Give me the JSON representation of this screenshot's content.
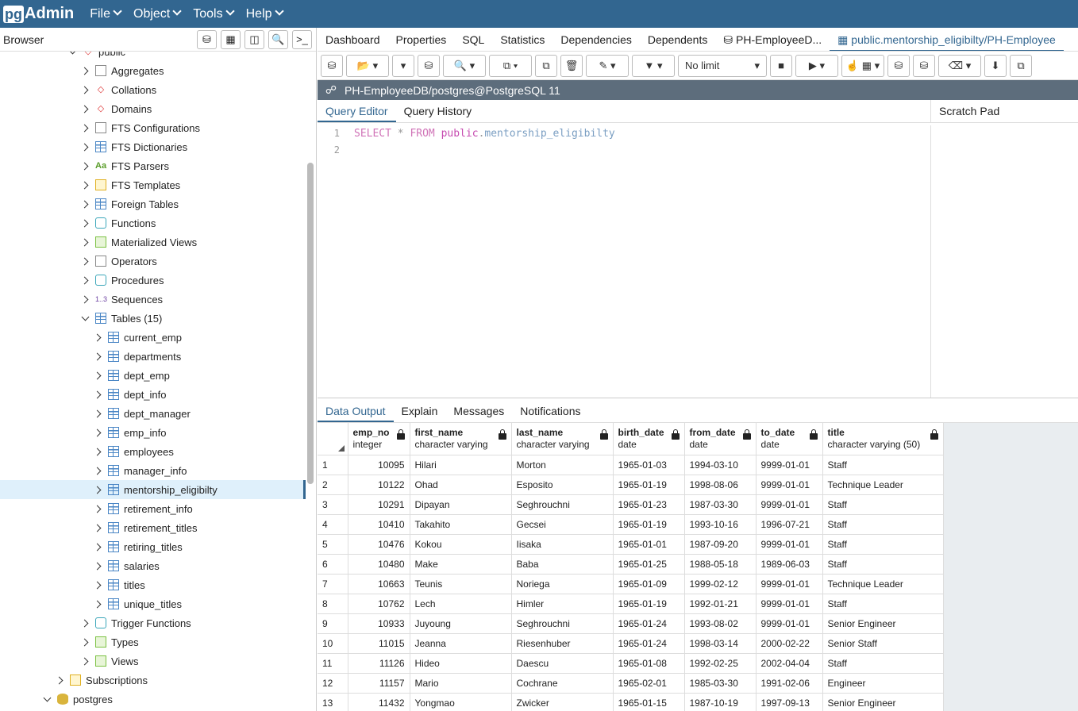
{
  "app": {
    "logo_pg": "pg",
    "logo_admin": "Admin"
  },
  "menu": [
    "File",
    "Object",
    "Tools",
    "Help"
  ],
  "browser": {
    "title": "Browser"
  },
  "tree": [
    {
      "label": "public",
      "indent": 86,
      "chev": "d",
      "icon": "red"
    },
    {
      "label": "Aggregates",
      "indent": 102,
      "chev": "r",
      "icon": "gry"
    },
    {
      "label": "Collations",
      "indent": 102,
      "chev": "r",
      "icon": "red"
    },
    {
      "label": "Domains",
      "indent": 102,
      "chev": "r",
      "icon": "red"
    },
    {
      "label": "FTS Configurations",
      "indent": 102,
      "chev": "r",
      "icon": "gry"
    },
    {
      "label": "FTS Dictionaries",
      "indent": 102,
      "chev": "r",
      "icon": "tbl"
    },
    {
      "label": "FTS Parsers",
      "indent": 102,
      "chev": "r",
      "icon": "aa"
    },
    {
      "label": "FTS Templates",
      "indent": 102,
      "chev": "r",
      "icon": "yel"
    },
    {
      "label": "Foreign Tables",
      "indent": 102,
      "chev": "r",
      "icon": "tbl"
    },
    {
      "label": "Functions",
      "indent": 102,
      "chev": "r",
      "icon": "teal"
    },
    {
      "label": "Materialized Views",
      "indent": 102,
      "chev": "r",
      "icon": "grn"
    },
    {
      "label": "Operators",
      "indent": 102,
      "chev": "r",
      "icon": "gry"
    },
    {
      "label": "Procedures",
      "indent": 102,
      "chev": "r",
      "icon": "teal"
    },
    {
      "label": "Sequences",
      "indent": 102,
      "chev": "r",
      "icon": "seq"
    },
    {
      "label": "Tables (15)",
      "indent": 102,
      "chev": "d",
      "icon": "tbl"
    },
    {
      "label": "current_emp",
      "indent": 118,
      "chev": "r",
      "icon": "tbl"
    },
    {
      "label": "departments",
      "indent": 118,
      "chev": "r",
      "icon": "tbl"
    },
    {
      "label": "dept_emp",
      "indent": 118,
      "chev": "r",
      "icon": "tbl"
    },
    {
      "label": "dept_info",
      "indent": 118,
      "chev": "r",
      "icon": "tbl"
    },
    {
      "label": "dept_manager",
      "indent": 118,
      "chev": "r",
      "icon": "tbl"
    },
    {
      "label": "emp_info",
      "indent": 118,
      "chev": "r",
      "icon": "tbl"
    },
    {
      "label": "employees",
      "indent": 118,
      "chev": "r",
      "icon": "tbl"
    },
    {
      "label": "manager_info",
      "indent": 118,
      "chev": "r",
      "icon": "tbl"
    },
    {
      "label": "mentorship_eligibilty",
      "indent": 118,
      "chev": "r",
      "icon": "tbl",
      "selected": true
    },
    {
      "label": "retirement_info",
      "indent": 118,
      "chev": "r",
      "icon": "tbl"
    },
    {
      "label": "retirement_titles",
      "indent": 118,
      "chev": "r",
      "icon": "tbl"
    },
    {
      "label": "retiring_titles",
      "indent": 118,
      "chev": "r",
      "icon": "tbl"
    },
    {
      "label": "salaries",
      "indent": 118,
      "chev": "r",
      "icon": "tbl"
    },
    {
      "label": "titles",
      "indent": 118,
      "chev": "r",
      "icon": "tbl"
    },
    {
      "label": "unique_titles",
      "indent": 118,
      "chev": "r",
      "icon": "tbl"
    },
    {
      "label": "Trigger Functions",
      "indent": 102,
      "chev": "r",
      "icon": "teal"
    },
    {
      "label": "Types",
      "indent": 102,
      "chev": "r",
      "icon": "grn"
    },
    {
      "label": "Views",
      "indent": 102,
      "chev": "r",
      "icon": "grn"
    },
    {
      "label": "Subscriptions",
      "indent": 70,
      "chev": "r",
      "icon": "yel"
    },
    {
      "label": "postgres",
      "indent": 54,
      "chev": "d",
      "icon": "db"
    }
  ],
  "tabs": [
    "Dashboard",
    "Properties",
    "SQL",
    "Statistics",
    "Dependencies",
    "Dependents",
    "PH-EmployeeD...",
    "public.mentorship_eligibilty/PH-Employee"
  ],
  "toolbar": {
    "limit": "No limit"
  },
  "connection": "PH-EmployeeDB/postgres@PostgreSQL 11",
  "query_tabs": [
    "Query Editor",
    "Query History"
  ],
  "scratch_pad": "Scratch Pad",
  "editor": {
    "line_numbers": [
      "1",
      "2"
    ],
    "kw_select": "SELECT",
    "star": "*",
    "kw_from": "FROM",
    "schema": "public",
    "dot": ".",
    "object": "mentorship_eligibilty"
  },
  "output_tabs": [
    "Data Output",
    "Explain",
    "Messages",
    "Notifications"
  ],
  "columns": [
    {
      "name": "emp_no",
      "type": "integer"
    },
    {
      "name": "first_name",
      "type": "character varying"
    },
    {
      "name": "last_name",
      "type": "character varying"
    },
    {
      "name": "birth_date",
      "type": "date"
    },
    {
      "name": "from_date",
      "type": "date"
    },
    {
      "name": "to_date",
      "type": "date"
    },
    {
      "name": "title",
      "type": "character varying (50)"
    }
  ],
  "rows": [
    [
      "1",
      "10095",
      "Hilari",
      "Morton",
      "1965-01-03",
      "1994-03-10",
      "9999-01-01",
      "Staff"
    ],
    [
      "2",
      "10122",
      "Ohad",
      "Esposito",
      "1965-01-19",
      "1998-08-06",
      "9999-01-01",
      "Technique Leader"
    ],
    [
      "3",
      "10291",
      "Dipayan",
      "Seghrouchni",
      "1965-01-23",
      "1987-03-30",
      "9999-01-01",
      "Staff"
    ],
    [
      "4",
      "10410",
      "Takahito",
      "Gecsei",
      "1965-01-19",
      "1993-10-16",
      "1996-07-21",
      "Staff"
    ],
    [
      "5",
      "10476",
      "Kokou",
      "Iisaka",
      "1965-01-01",
      "1987-09-20",
      "9999-01-01",
      "Staff"
    ],
    [
      "6",
      "10480",
      "Make",
      "Baba",
      "1965-01-25",
      "1988-05-18",
      "1989-06-03",
      "Staff"
    ],
    [
      "7",
      "10663",
      "Teunis",
      "Noriega",
      "1965-01-09",
      "1999-02-12",
      "9999-01-01",
      "Technique Leader"
    ],
    [
      "8",
      "10762",
      "Lech",
      "Himler",
      "1965-01-19",
      "1992-01-21",
      "9999-01-01",
      "Staff"
    ],
    [
      "9",
      "10933",
      "Juyoung",
      "Seghrouchni",
      "1965-01-24",
      "1993-08-02",
      "9999-01-01",
      "Senior Engineer"
    ],
    [
      "10",
      "11015",
      "Jeanna",
      "Riesenhuber",
      "1965-01-24",
      "1998-03-14",
      "2000-02-22",
      "Senior Staff"
    ],
    [
      "11",
      "11126",
      "Hideo",
      "Daescu",
      "1965-01-08",
      "1992-02-25",
      "2002-04-04",
      "Staff"
    ],
    [
      "12",
      "11157",
      "Mario",
      "Cochrane",
      "1965-02-01",
      "1985-03-30",
      "1991-02-06",
      "Engineer"
    ],
    [
      "13",
      "11432",
      "Yongmao",
      "Zwicker",
      "1965-01-15",
      "1987-10-19",
      "1997-09-13",
      "Senior Engineer"
    ]
  ]
}
